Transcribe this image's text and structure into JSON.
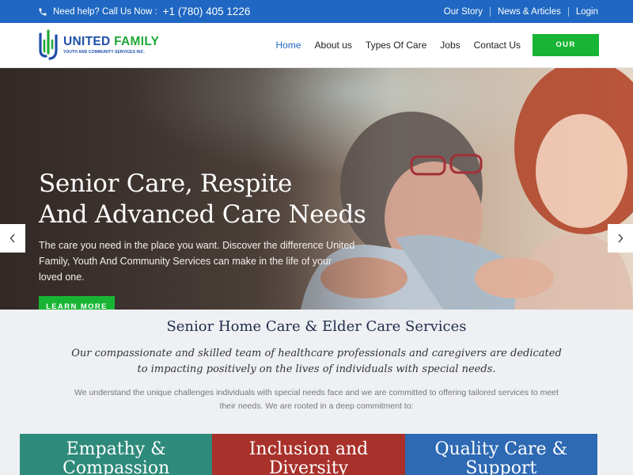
{
  "topbar": {
    "help_text": "Need help? Call Us Now :",
    "phone": "+1 (780) 405 1226",
    "links": [
      "Our Story",
      "News & Articles",
      "Login"
    ]
  },
  "logo": {
    "brand_a": "UNITED",
    "brand_b": "FAMILY",
    "tagline": "YOUTH AND COMMUNITY SERVICES INC."
  },
  "nav": {
    "items": [
      "Home",
      "About us",
      "Types Of Care",
      "Jobs",
      "Contact Us"
    ],
    "faq_button": "OUR FAQS"
  },
  "hero": {
    "title_line1": "Senior Care, Respite",
    "title_line2": "And Advanced Care Needs",
    "text": "The care you need in the place you want. Discover the difference United Family, Youth And Community Services can make in the life of your loved one.",
    "button": "LEARN MORE",
    "prev_icon": "chevron-left-icon",
    "next_icon": "chevron-right-icon"
  },
  "services": {
    "heading": "Senior Home Care & Elder Care Services",
    "lead": "Our compassionate and skilled team of healthcare professionals and caregivers are dedicated to impacting positively on the lives of individuals with special needs.",
    "intro": "We understand the unique challenges individuals with special needs face and we are committed to offering tailored services to meet their needs. We are rooted in a deep commitment to:",
    "cards": [
      {
        "line1": "Empathy &",
        "line2": "Compassion"
      },
      {
        "line1": "Inclusion and",
        "line2": "Diversity"
      },
      {
        "line1": "Quality Care &",
        "line2": "Support"
      }
    ]
  },
  "colors": {
    "topbar": "#1f67c2",
    "accent_green": "#18b534",
    "nav_active": "#1f67c2",
    "card_teal": "#2e8a7a",
    "card_red": "#a8312b",
    "card_blue": "#2e69b3"
  }
}
